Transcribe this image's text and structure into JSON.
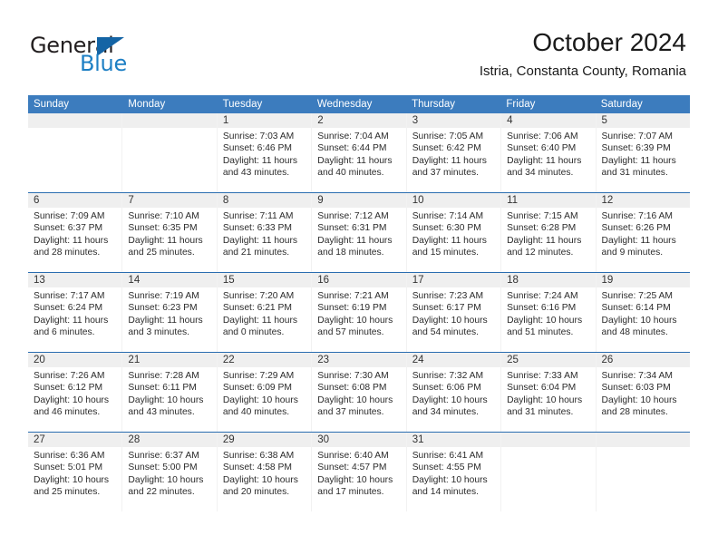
{
  "brand": {
    "name_top": "General",
    "name_bottom": "Blue",
    "accent_color": "#1464a5",
    "text_color": "#231f20"
  },
  "header": {
    "title": "October 2024",
    "subtitle": "Istria, Constanta County, Romania"
  },
  "theme": {
    "header_row_bg": "#3c7cbe",
    "week_divider": "#2a6db0",
    "day_number_bg": "#efefef"
  },
  "weekdays": [
    "Sunday",
    "Monday",
    "Tuesday",
    "Wednesday",
    "Thursday",
    "Friday",
    "Saturday"
  ],
  "weeks": [
    [
      {
        "day": "",
        "empty": true,
        "sunrise": "",
        "sunset": "",
        "daylight": ""
      },
      {
        "day": "",
        "empty": true,
        "sunrise": "",
        "sunset": "",
        "daylight": ""
      },
      {
        "day": "1",
        "sunrise": "Sunrise: 7:03 AM",
        "sunset": "Sunset: 6:46 PM",
        "daylight": "Daylight: 11 hours and 43 minutes."
      },
      {
        "day": "2",
        "sunrise": "Sunrise: 7:04 AM",
        "sunset": "Sunset: 6:44 PM",
        "daylight": "Daylight: 11 hours and 40 minutes."
      },
      {
        "day": "3",
        "sunrise": "Sunrise: 7:05 AM",
        "sunset": "Sunset: 6:42 PM",
        "daylight": "Daylight: 11 hours and 37 minutes."
      },
      {
        "day": "4",
        "sunrise": "Sunrise: 7:06 AM",
        "sunset": "Sunset: 6:40 PM",
        "daylight": "Daylight: 11 hours and 34 minutes."
      },
      {
        "day": "5",
        "sunrise": "Sunrise: 7:07 AM",
        "sunset": "Sunset: 6:39 PM",
        "daylight": "Daylight: 11 hours and 31 minutes."
      }
    ],
    [
      {
        "day": "6",
        "sunrise": "Sunrise: 7:09 AM",
        "sunset": "Sunset: 6:37 PM",
        "daylight": "Daylight: 11 hours and 28 minutes."
      },
      {
        "day": "7",
        "sunrise": "Sunrise: 7:10 AM",
        "sunset": "Sunset: 6:35 PM",
        "daylight": "Daylight: 11 hours and 25 minutes."
      },
      {
        "day": "8",
        "sunrise": "Sunrise: 7:11 AM",
        "sunset": "Sunset: 6:33 PM",
        "daylight": "Daylight: 11 hours and 21 minutes."
      },
      {
        "day": "9",
        "sunrise": "Sunrise: 7:12 AM",
        "sunset": "Sunset: 6:31 PM",
        "daylight": "Daylight: 11 hours and 18 minutes."
      },
      {
        "day": "10",
        "sunrise": "Sunrise: 7:14 AM",
        "sunset": "Sunset: 6:30 PM",
        "daylight": "Daylight: 11 hours and 15 minutes."
      },
      {
        "day": "11",
        "sunrise": "Sunrise: 7:15 AM",
        "sunset": "Sunset: 6:28 PM",
        "daylight": "Daylight: 11 hours and 12 minutes."
      },
      {
        "day": "12",
        "sunrise": "Sunrise: 7:16 AM",
        "sunset": "Sunset: 6:26 PM",
        "daylight": "Daylight: 11 hours and 9 minutes."
      }
    ],
    [
      {
        "day": "13",
        "sunrise": "Sunrise: 7:17 AM",
        "sunset": "Sunset: 6:24 PM",
        "daylight": "Daylight: 11 hours and 6 minutes."
      },
      {
        "day": "14",
        "sunrise": "Sunrise: 7:19 AM",
        "sunset": "Sunset: 6:23 PM",
        "daylight": "Daylight: 11 hours and 3 minutes."
      },
      {
        "day": "15",
        "sunrise": "Sunrise: 7:20 AM",
        "sunset": "Sunset: 6:21 PM",
        "daylight": "Daylight: 11 hours and 0 minutes."
      },
      {
        "day": "16",
        "sunrise": "Sunrise: 7:21 AM",
        "sunset": "Sunset: 6:19 PM",
        "daylight": "Daylight: 10 hours and 57 minutes."
      },
      {
        "day": "17",
        "sunrise": "Sunrise: 7:23 AM",
        "sunset": "Sunset: 6:17 PM",
        "daylight": "Daylight: 10 hours and 54 minutes."
      },
      {
        "day": "18",
        "sunrise": "Sunrise: 7:24 AM",
        "sunset": "Sunset: 6:16 PM",
        "daylight": "Daylight: 10 hours and 51 minutes."
      },
      {
        "day": "19",
        "sunrise": "Sunrise: 7:25 AM",
        "sunset": "Sunset: 6:14 PM",
        "daylight": "Daylight: 10 hours and 48 minutes."
      }
    ],
    [
      {
        "day": "20",
        "sunrise": "Sunrise: 7:26 AM",
        "sunset": "Sunset: 6:12 PM",
        "daylight": "Daylight: 10 hours and 46 minutes."
      },
      {
        "day": "21",
        "sunrise": "Sunrise: 7:28 AM",
        "sunset": "Sunset: 6:11 PM",
        "daylight": "Daylight: 10 hours and 43 minutes."
      },
      {
        "day": "22",
        "sunrise": "Sunrise: 7:29 AM",
        "sunset": "Sunset: 6:09 PM",
        "daylight": "Daylight: 10 hours and 40 minutes."
      },
      {
        "day": "23",
        "sunrise": "Sunrise: 7:30 AM",
        "sunset": "Sunset: 6:08 PM",
        "daylight": "Daylight: 10 hours and 37 minutes."
      },
      {
        "day": "24",
        "sunrise": "Sunrise: 7:32 AM",
        "sunset": "Sunset: 6:06 PM",
        "daylight": "Daylight: 10 hours and 34 minutes."
      },
      {
        "day": "25",
        "sunrise": "Sunrise: 7:33 AM",
        "sunset": "Sunset: 6:04 PM",
        "daylight": "Daylight: 10 hours and 31 minutes."
      },
      {
        "day": "26",
        "sunrise": "Sunrise: 7:34 AM",
        "sunset": "Sunset: 6:03 PM",
        "daylight": "Daylight: 10 hours and 28 minutes."
      }
    ],
    [
      {
        "day": "27",
        "sunrise": "Sunrise: 6:36 AM",
        "sunset": "Sunset: 5:01 PM",
        "daylight": "Daylight: 10 hours and 25 minutes."
      },
      {
        "day": "28",
        "sunrise": "Sunrise: 6:37 AM",
        "sunset": "Sunset: 5:00 PM",
        "daylight": "Daylight: 10 hours and 22 minutes."
      },
      {
        "day": "29",
        "sunrise": "Sunrise: 6:38 AM",
        "sunset": "Sunset: 4:58 PM",
        "daylight": "Daylight: 10 hours and 20 minutes."
      },
      {
        "day": "30",
        "sunrise": "Sunrise: 6:40 AM",
        "sunset": "Sunset: 4:57 PM",
        "daylight": "Daylight: 10 hours and 17 minutes."
      },
      {
        "day": "31",
        "sunrise": "Sunrise: 6:41 AM",
        "sunset": "Sunset: 4:55 PM",
        "daylight": "Daylight: 10 hours and 14 minutes."
      },
      {
        "day": "",
        "empty": true,
        "sunrise": "",
        "sunset": "",
        "daylight": ""
      },
      {
        "day": "",
        "empty": true,
        "sunrise": "",
        "sunset": "",
        "daylight": ""
      }
    ]
  ]
}
